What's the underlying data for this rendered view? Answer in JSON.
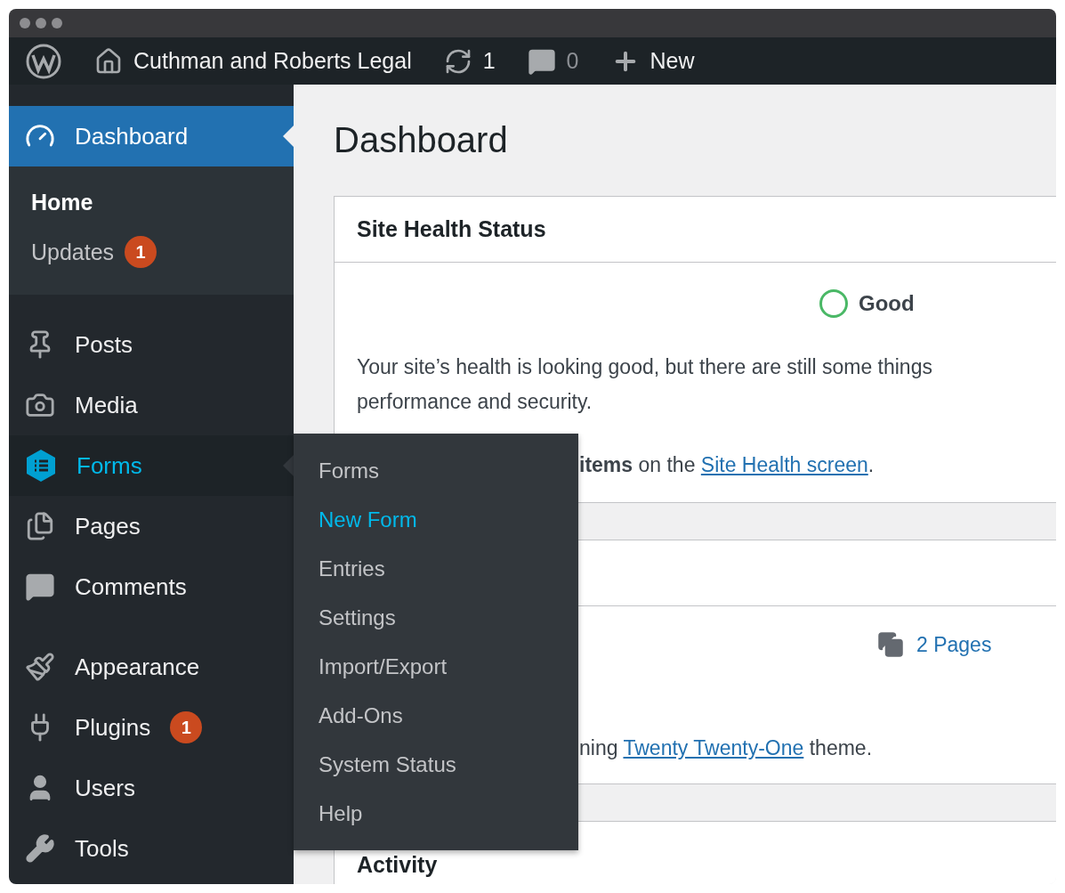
{
  "admin_bar": {
    "site_name": "Cuthman and Roberts Legal",
    "updates_count": "1",
    "comments_count": "0",
    "new_label": "New"
  },
  "sidebar": {
    "sections": [
      [
        {
          "label": "Dashboard",
          "selected": true,
          "open": false,
          "submenu": [
            {
              "label": "Home",
              "selected": true
            },
            {
              "label": "Updates",
              "badge": "1",
              "selected": false
            }
          ]
        }
      ],
      [
        {
          "label": "Posts",
          "selected": false,
          "open": false
        },
        {
          "label": "Media",
          "selected": false,
          "open": false
        },
        {
          "label": "Forms",
          "selected": false,
          "open": true,
          "flyout": [
            {
              "label": "Forms",
              "selected": false
            },
            {
              "label": "New Form",
              "selected": true
            },
            {
              "label": "Entries",
              "selected": false
            },
            {
              "label": "Settings",
              "selected": false
            },
            {
              "label": "Import/Export",
              "selected": false
            },
            {
              "label": "Add-Ons",
              "selected": false
            },
            {
              "label": "System Status",
              "selected": false
            },
            {
              "label": "Help",
              "selected": false
            }
          ]
        },
        {
          "label": "Pages",
          "selected": false,
          "open": false
        },
        {
          "label": "Comments",
          "selected": false,
          "open": false
        }
      ],
      [
        {
          "label": "Appearance",
          "selected": false,
          "open": false
        },
        {
          "label": "Plugins",
          "badge": "1",
          "selected": false,
          "open": false
        },
        {
          "label": "Users",
          "selected": false,
          "open": false
        },
        {
          "label": "Tools",
          "selected": false,
          "open": false
        }
      ]
    ]
  },
  "main": {
    "heading": "Dashboard",
    "site_health": {
      "title": "Site Health Status",
      "status": "Good",
      "paragraph_lines": [
        "Your site’s health is looking good, but there are still some things",
        "performance and security."
      ],
      "items_text": "**items** on the",
      "link": "Site Health screen",
      "after_link": "."
    },
    "at_a_glance": {
      "pages": "2 Pages",
      "theme_before": "ning",
      "theme_link": "Twenty Twenty-One",
      "theme_after": "theme."
    },
    "activity": {
      "title": "Activity"
    }
  }
}
